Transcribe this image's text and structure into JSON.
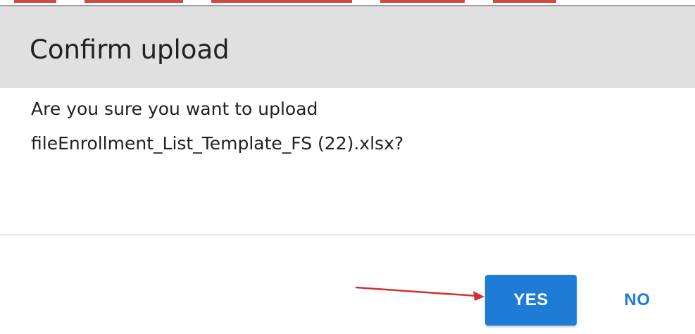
{
  "dialog": {
    "title": "Confirm upload",
    "message_line1": "Are you sure you want to upload",
    "message_line2": "fileEnrollment_List_Template_FS (22).xlsx?"
  },
  "actions": {
    "yes_label": "YES",
    "no_label": "NO"
  },
  "colors": {
    "primary": "#1e7bd6",
    "header_bg": "#e0e0e0",
    "annotation": "#d32f2f"
  },
  "annotation": {
    "icon": "red-arrow-icon",
    "points_to": "yes-button"
  }
}
